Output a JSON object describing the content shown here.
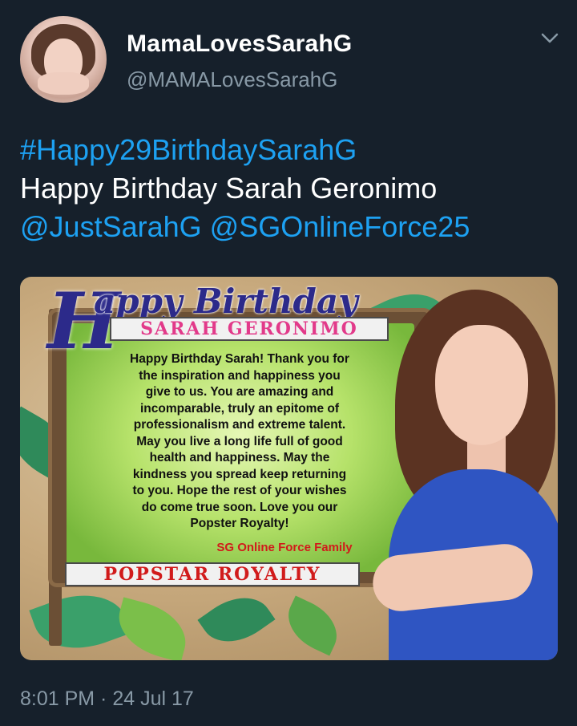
{
  "user": {
    "display_name": "MamaLovesSarahG",
    "handle": "@MAMALovesSarahG",
    "avatar_icon": "profile-photo",
    "menu_icon": "chevron-down-icon"
  },
  "tweet": {
    "hashtag": "#Happy29BirthdaySarahG",
    "line2": "Happy Birthday Sarah Geronimo",
    "mention1": "@JustSarahG",
    "mention2": "@SGOnlineForce25",
    "timestamp": "8:01 PM · 24 Jul 17"
  },
  "image": {
    "title_cap": "H",
    "title_rest": "appy Birthday",
    "name_banner": "SARAH GERONIMO",
    "message_lines": [
      "Happy Birthday Sarah! Thank you for",
      "the inspiration and happiness you",
      "give to us.  You are amazing and",
      "incomparable, truly an epitome of",
      "professionalism and extreme talent.",
      "May you live a long life full of good",
      "health and happiness. May the",
      "kindness you spread keep returning",
      "to you. Hope the rest of your wishes",
      "do come true soon. Love you our",
      "Popster Royalty!"
    ],
    "signature": "SG Online Force Family",
    "bottom_banner": "POPSTAR ROYALTY"
  },
  "colors": {
    "background": "#16202b",
    "link": "#1da1f2",
    "secondary_text": "#8899a6"
  }
}
